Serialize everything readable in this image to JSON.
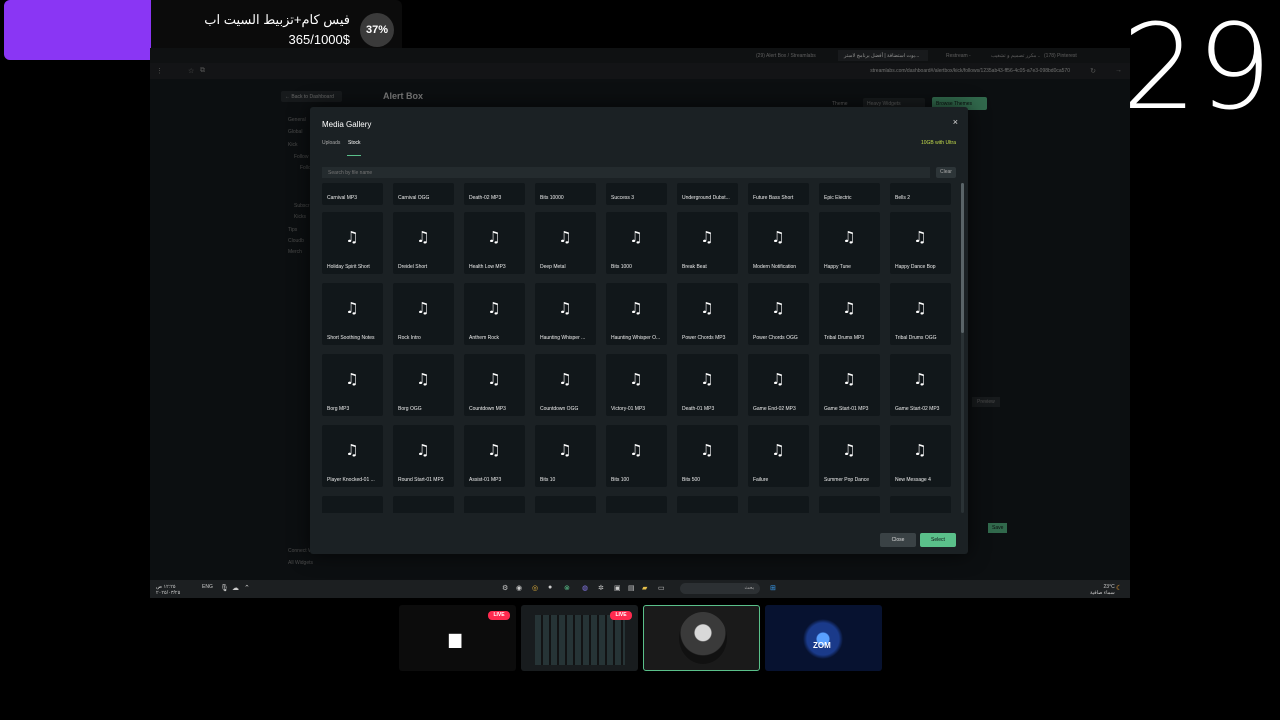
{
  "donation": {
    "title": "فيس كام+تزبيط السيت اب",
    "amount": "365/1000$",
    "percent": "37%",
    "progress_fraction": 0.37,
    "accent_color": "#8a36f4"
  },
  "counter": "29",
  "browser": {
    "tabs": [
      "(29) Alert Box / Streamlabs",
      "بوت استضافة | أفضل برنامج لاستر...",
      "Restream -",
      "مكرر تصميم و تشغيب ...",
      "(178) Pinterest"
    ],
    "url": "streamlabs.com/dashboard#/alertbox/kick/follows/1235ab43-ff56-4c05-a7e3-098bd0ca570"
  },
  "page": {
    "back_label": "← Back to Dashboard",
    "title": "Alert Box",
    "theme_label": "Theme",
    "theme_value": "Heavy Widgets",
    "browse_themes": "Browse Themes",
    "sidebar": [
      "General",
      "Global",
      "Kick",
      "Follow",
      "Follo",
      "Subscr",
      "Kicks",
      "Tips",
      "Cloudb",
      "Merch"
    ],
    "footer_links": [
      "Connect Widget",
      "All Widgets"
    ],
    "preview_label": "Preview",
    "save_label": "Save"
  },
  "modal": {
    "title": "Media Gallery",
    "tabs": [
      "Uploads",
      "Stock"
    ],
    "active_tab": "Stock",
    "ultra_note": "10GB with Ultra",
    "search_placeholder": "Search by file name",
    "clear_label": "Clear",
    "close_label": "Close",
    "select_label": "Select",
    "items": [
      [
        "Carnival MP3",
        "Carnival OGG",
        "Death-02 MP3",
        "Bits 10000",
        "Success 3",
        "Underground Dubst...",
        "Future Bass Short",
        "Epic Electric",
        "Bells 2"
      ],
      [
        "Holiday Spirit Short",
        "Dreidel Short",
        "Health Low MP3",
        "Deep Metal",
        "Bits 1000",
        "Break Beat",
        "Modern Notification",
        "Happy Tune",
        "Happy Dance Bop"
      ],
      [
        "Short Soothing Notes",
        "Rock Intro",
        "Anthem Rock",
        "Haunting Whisper ...",
        "Haunting Whisper O...",
        "Power Chords MP3",
        "Power Chords OGG",
        "Tribal Drums MP3",
        "Tribal Drums OGG"
      ],
      [
        "Borg MP3",
        "Borg OGG",
        "Countdown MP3",
        "Countdown OGG",
        "Victory-01 MP3",
        "Death-01 MP3",
        "Game End-02 MP3",
        "Game Start-01 MP3",
        "Game Start-02 MP3"
      ],
      [
        "Player Knocked-01 ...",
        "Round Start-01 MP3",
        "Assist-01 MP3",
        "Bits 10",
        "Bits 100",
        "Bits 500",
        "Failure",
        "Summer Pop Dance",
        "New Message 4"
      ]
    ]
  },
  "taskbar": {
    "search_text": "بحث",
    "left_time": "١٢:٢٥ ص",
    "left_date": "٢٠٢٥/٠٣/٢٥",
    "lang": "ENG",
    "weather": "23°C",
    "weather_desc": "سماء صافية"
  },
  "thumbnails": [
    {
      "name": "screen-share",
      "live": "LIVE"
    },
    {
      "name": "keyboard-cam",
      "live": "LIVE"
    },
    {
      "name": "face-cam",
      "live": ""
    },
    {
      "name": "zom-logo",
      "live": ""
    }
  ]
}
